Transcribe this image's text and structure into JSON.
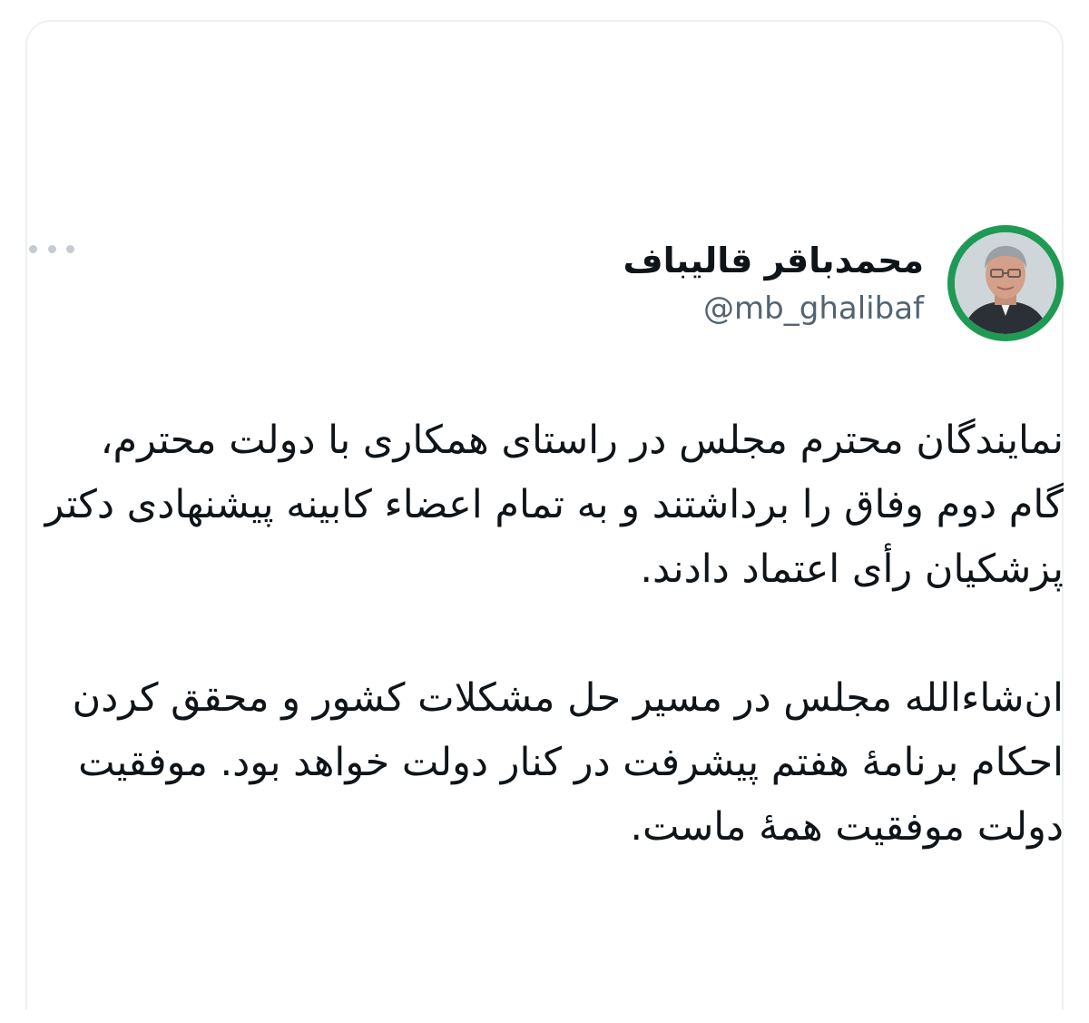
{
  "author": {
    "display_name": "محمدباقر قالیباف",
    "handle": "@mb_ghalibaf"
  },
  "tweet": {
    "paragraphs": [
      "نمایندگان محترم مجلس در راستای همکاری با دولت محترم، گام دوم وفاق را برداشتند و به تمام اعضاء کابینه پیشنهادی دکتر پزشکیان رأی اعتماد دادند.",
      "ان‌شاءالله مجلس در مسیر حل مشکلات کشور و محقق کردن احکام برنامهٔ هفتم پیشرفت در کنار دولت خواهد بود. موفقیت دولت موفقیت همهٔ ماست."
    ]
  },
  "icons": {
    "more": "more-horizontal-icon",
    "avatar": "avatar"
  },
  "colors": {
    "avatar_ring": "#1f9a55",
    "handle_text": "#536471",
    "body_text": "#0f1419",
    "more_dots": "#c5cbd1"
  }
}
